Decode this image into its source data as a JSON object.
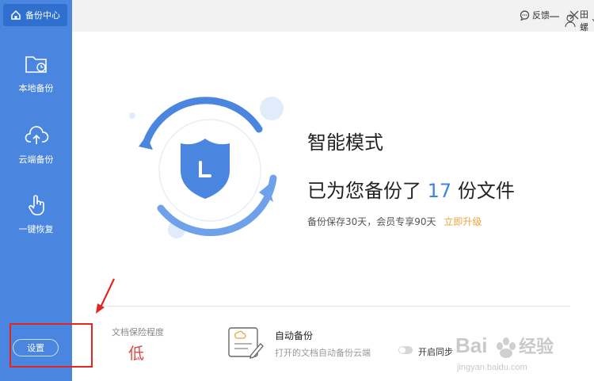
{
  "brand": {
    "title": "备份中心",
    "icon": "cloud-home-icon"
  },
  "sidebar": {
    "items": [
      {
        "label": "本地备份",
        "icon": "folder-clock-icon"
      },
      {
        "label": "云端备份",
        "icon": "cloud-upload-icon"
      },
      {
        "label": "一键恢复",
        "icon": "hand-pointer-icon"
      }
    ],
    "settings_label": "设置"
  },
  "topbar": {
    "feedback_label": "反馈",
    "user_name": "田螺"
  },
  "hero": {
    "mode_title": "智能模式",
    "backup_prefix": "已为您备份了",
    "backup_count": "17",
    "backup_suffix": "份文件",
    "retention_text": "备份保存30天，会员专享90天",
    "upgrade_link": "立即升级"
  },
  "protection": {
    "label": "文档保险程度",
    "level": "低"
  },
  "auto_backup": {
    "title": "自动备份",
    "description": "打开的文档自动备份云端",
    "sync_label": "开启同步",
    "sync_enabled": false
  },
  "watermark": {
    "text": "Baidu经验",
    "url_text": "jingyan.baidu.com"
  },
  "colors": {
    "sidebar": "#4a86e0",
    "accent": "#3b83e6",
    "upgrade": "#f0a23c",
    "level_low": "#e04848",
    "annotation": "#e0261f"
  }
}
